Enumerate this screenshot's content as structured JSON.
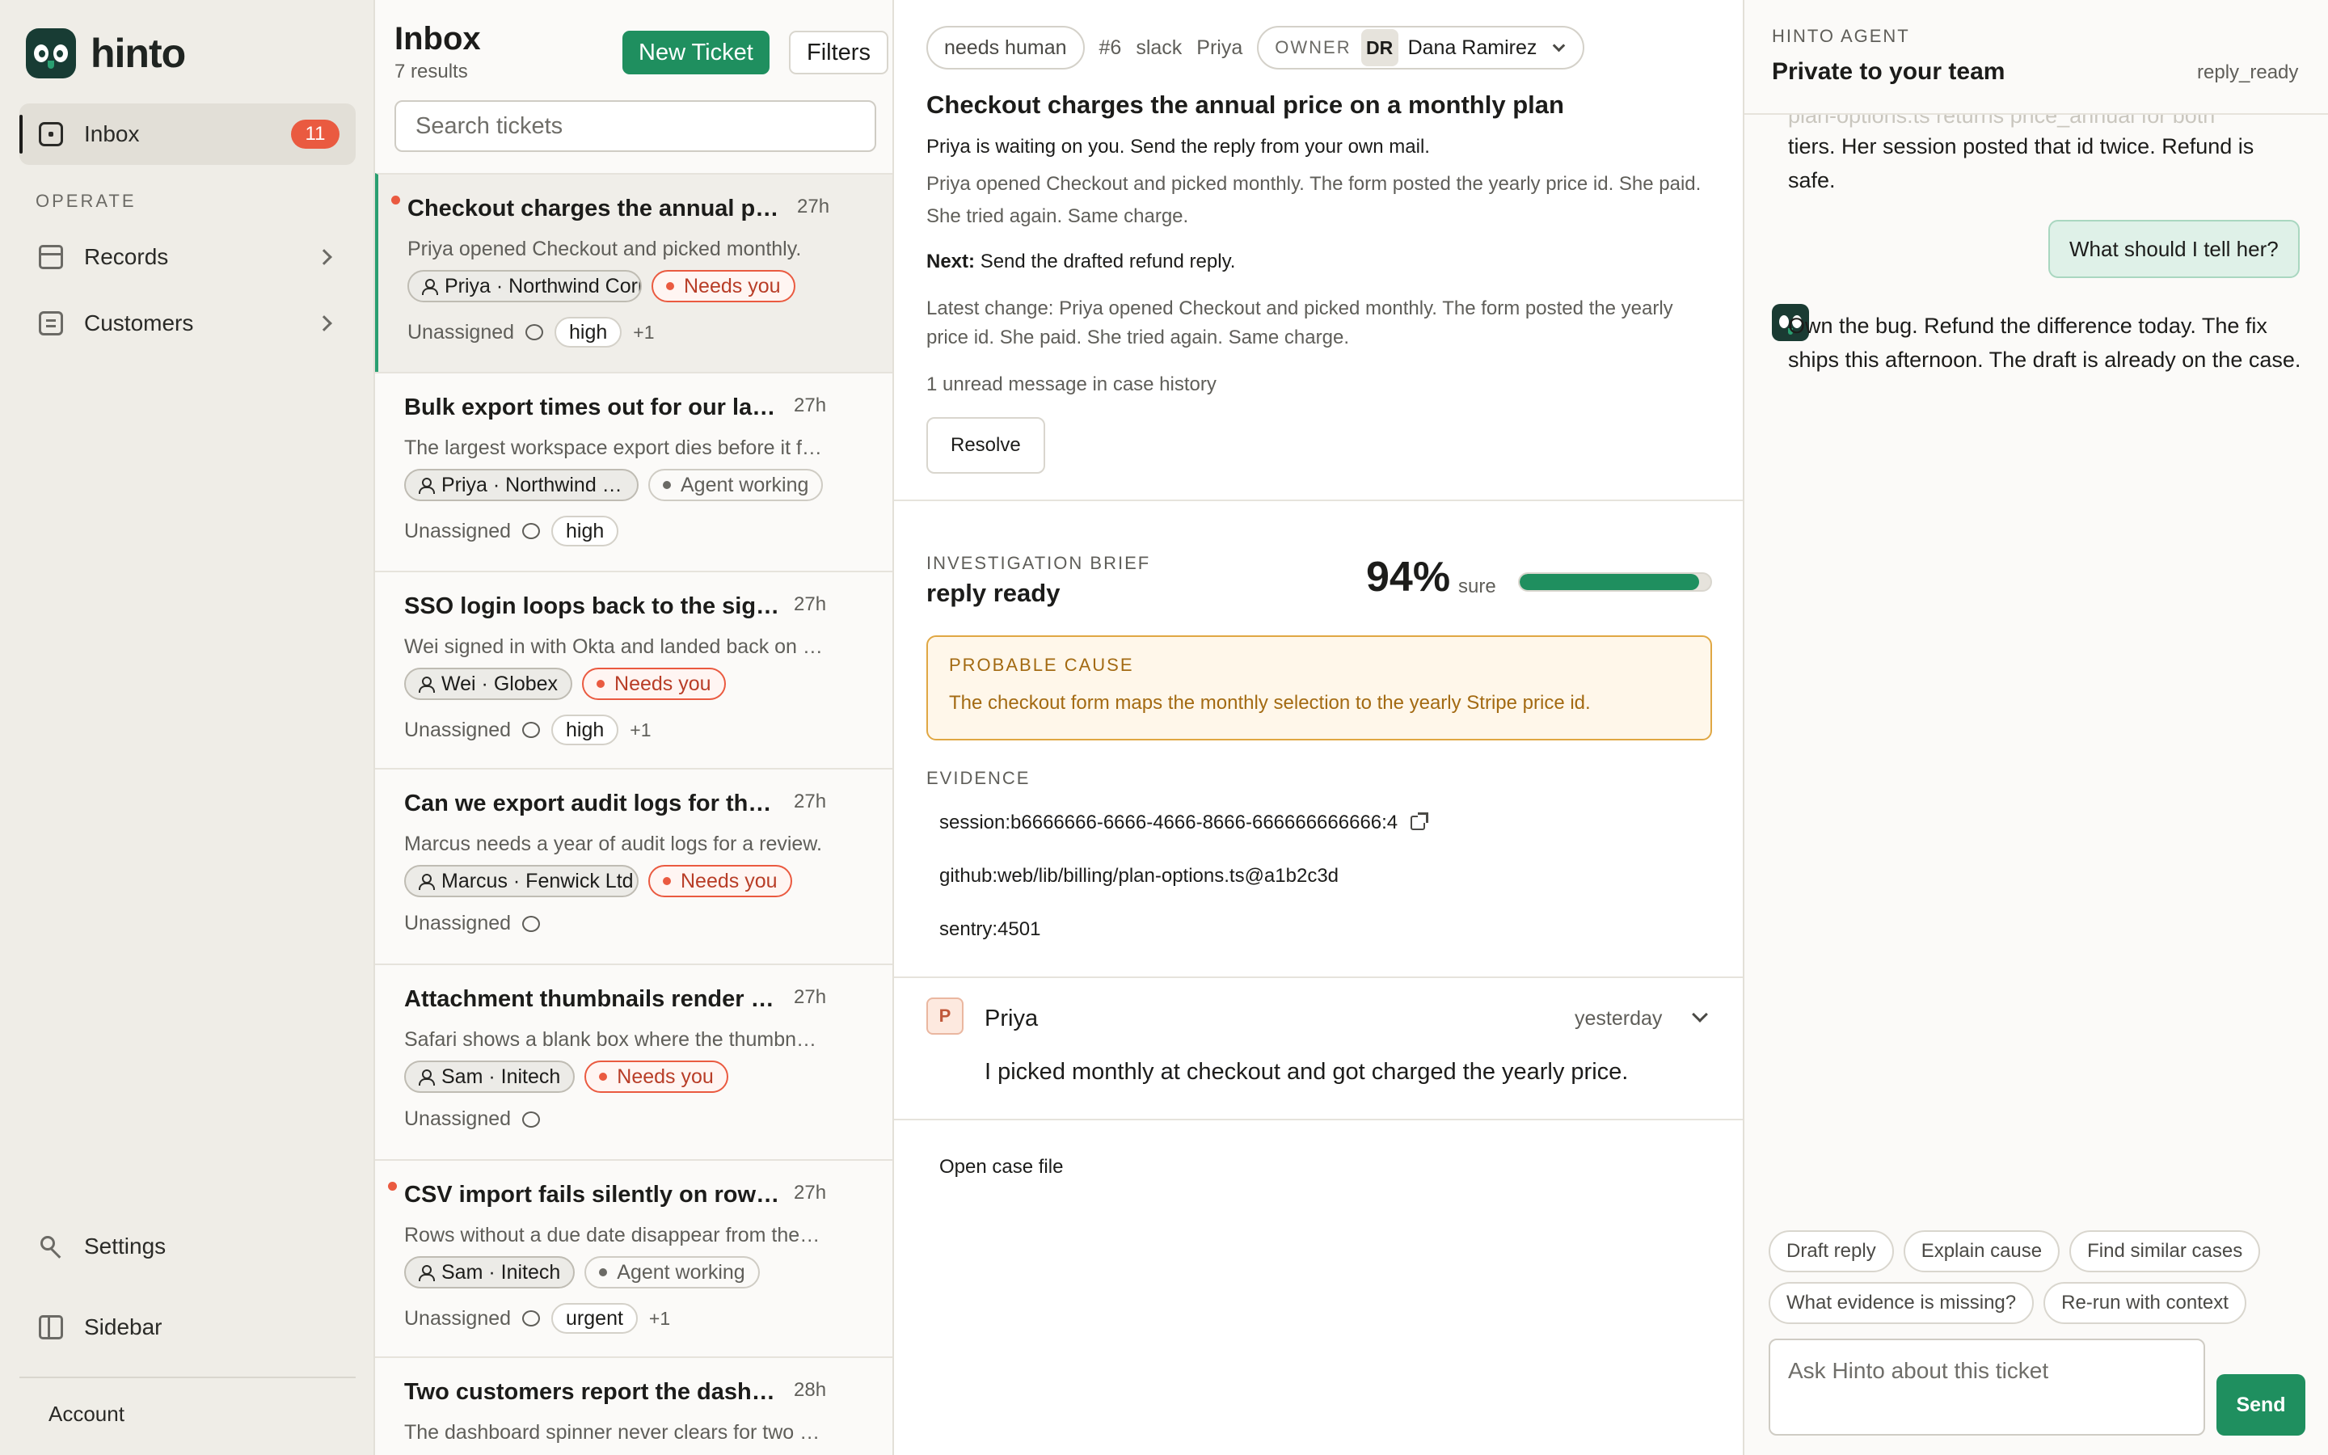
{
  "app": {
    "name": "hinto"
  },
  "sidebar": {
    "inbox": {
      "label": "Inbox",
      "count": "11"
    },
    "section": "OPERATE",
    "records": "Records",
    "customers": "Customers",
    "settings": "Settings",
    "sidebar_toggle": "Sidebar",
    "account": "Account"
  },
  "list": {
    "title": "Inbox",
    "count": "7 results",
    "new_ticket": "New Ticket",
    "filters": "Filters",
    "search_placeholder": "Search tickets",
    "tickets": [
      {
        "title": "Checkout charges the annual price on a monthly plan",
        "age": "27h",
        "preview": "Priya opened Checkout and picked monthly.",
        "customer": "Priya · Northwind Corp",
        "status": "Needs you",
        "assignee": "Unassigned",
        "priority": "high",
        "extra": "+1"
      },
      {
        "title": "Bulk export times out for our largest workspace",
        "age": "27h",
        "preview": "The largest workspace export dies before it finishes.",
        "customer": "Priya · Northwind Corp",
        "status": "Agent working",
        "assignee": "Unassigned",
        "priority": "high"
      },
      {
        "title": "SSO login loops back to the sign-in page",
        "age": "27h",
        "preview": "Wei signed in with Okta and landed back on the sign-in page.",
        "customer": "Wei · Globex",
        "status": "Needs you",
        "assignee": "Unassigned",
        "priority": "high",
        "extra": "+1"
      },
      {
        "title": "Can we export audit logs for the last year?",
        "age": "27h",
        "preview": "Marcus needs a year of audit logs for a review.",
        "customer": "Marcus · Fenwick Ltd",
        "status": "Needs you",
        "assignee": "Unassigned"
      },
      {
        "title": "Attachment thumbnails render blank in Safari",
        "age": "27h",
        "preview": "Safari shows a blank box where the thumbnail should be.",
        "customer": "Sam · Initech",
        "status": "Needs you",
        "assignee": "Unassigned"
      },
      {
        "title": "CSV import fails silently on rows without a due date",
        "age": "27h",
        "preview": "Rows without a due date disappear from the import.",
        "customer": "Sam · Initech",
        "status": "Agent working",
        "assignee": "Unassigned",
        "priority": "urgent",
        "extra": "+1"
      },
      {
        "title": "Two customers report the dashboard spinner never clears",
        "age": "28h",
        "preview": "The dashboard spinner never clears for two customers."
      }
    ]
  },
  "detail": {
    "status_pill": "needs human",
    "ticket_no": "#6",
    "channel": "slack",
    "requester": "Priya",
    "owner_label": "OWNER",
    "owner_initials": "DR",
    "owner_name": "Dana Ramirez",
    "title": "Checkout charges the annual price on a monthly plan",
    "waiting": "Priya is waiting on you. Send the reply from your own mail.",
    "description": "Priya opened Checkout and picked monthly. The form posted the yearly price id. She paid. She tried again. Same charge.",
    "next_label": "Next:",
    "next_text": "Send the drafted refund reply.",
    "latest": "Latest change: Priya opened Checkout and picked monthly. The form posted the yearly price id. She paid. She tried again. Same charge.",
    "unread": "1 unread message in case history",
    "resolve": "Resolve",
    "brief": {
      "label": "INVESTIGATION BRIEF",
      "status": "reply ready",
      "confidence": "94%",
      "confidence_value": 0.94,
      "confidence_word": "sure",
      "cause_label": "PROBABLE CAUSE",
      "cause_text": "The checkout form maps the monthly selection to the yearly Stripe price id.",
      "evidence_label": "EVIDENCE",
      "evidence": [
        "session:b6666666-6666-4666-8666-666666666666:4",
        "github:web/lib/billing/plan-options.ts@a1b2c3d",
        "sentry:4501"
      ]
    },
    "message": {
      "initial": "P",
      "name": "Priya",
      "time": "yesterday",
      "body": "I picked monthly at checkout and got charged the yearly price."
    },
    "open_case": "Open case file"
  },
  "agent": {
    "kicker": "HINTO AGENT",
    "title": "Private to your team",
    "state": "reply_ready",
    "faded": "plan-options.ts returns price_annual for both",
    "msg1": "tiers. Her session posted that id twice. Refund is safe.",
    "user_question": "What should I tell her?",
    "msg2": "Own the bug. Refund the difference today. The fix ships this afternoon. The draft is already on the case.",
    "suggestions_row1": [
      "Draft reply",
      "Explain cause",
      "Find similar cases"
    ],
    "suggestions_row2": [
      "What evidence is missing?",
      "Re-run with context"
    ],
    "ask_placeholder": "Ask Hinto about this ticket",
    "send": "Send"
  }
}
